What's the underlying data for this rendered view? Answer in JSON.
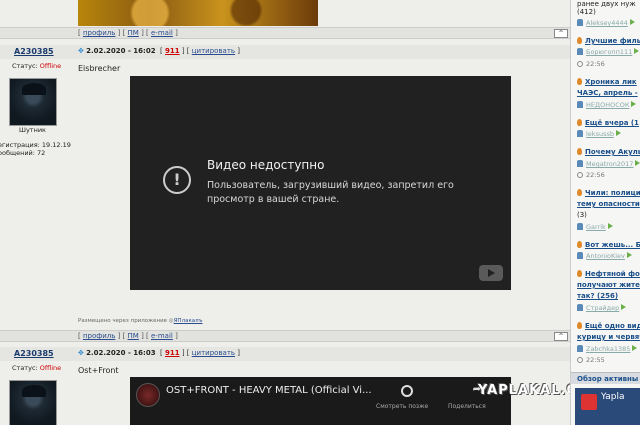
{
  "post_bar_links": [
    "профиль",
    "ПМ",
    "e-mail"
  ],
  "up_label": "^",
  "posts": [
    {
      "author": "A230385",
      "date": "2.02.2020 - 16:02",
      "number": "911",
      "quote": "цитировать",
      "status_label": "Статус:",
      "status_value": "Offline",
      "nick": "Шутник",
      "reg": "егистрация: 19.12.19",
      "count": "ообщений: 72",
      "title": "Eisbrecher",
      "video_title": "Видео недоступно",
      "video_desc": "Пользователь, загрузивший видео, запретил его просмотр в вашей стране.",
      "posted_via": "Размещено через приложение",
      "app_name": "ЯПлакалъ"
    },
    {
      "author": "A230385",
      "date": "2.02.2020 - 16:03",
      "number": "911",
      "quote": "цитировать",
      "status_label": "Статус:",
      "status_value": "Offline",
      "title": "Ost+Front",
      "video_title": "OST+FRONT - HEAVY METAL (Official Vi...",
      "watch_later": "Смотреть позже",
      "share": "Поделиться"
    }
  ],
  "sidebar": {
    "items": [
      {
        "type": "plain",
        "text": "ранее двух нуж"
      },
      {
        "type": "plain",
        "text": "(412)"
      },
      {
        "type": "user",
        "text": "Aleksey4444"
      },
      {
        "type": "hdr",
        "text": "Лучшие филь"
      },
      {
        "type": "user",
        "text": "Борюгопп111"
      },
      {
        "type": "time",
        "text": "22:56"
      },
      {
        "type": "hdr",
        "text": "Хроника лик"
      },
      {
        "type": "hdr",
        "text": "ЧАЭС, апрель -"
      },
      {
        "type": "user",
        "text": "НЕДОНОСОК"
      },
      {
        "type": "hdr",
        "text": "Ещё вчера (1"
      },
      {
        "type": "user",
        "text": "leksussb"
      },
      {
        "type": "hdr",
        "text": "Почему Акулы Б"
      },
      {
        "type": "user",
        "text": "Megatron2017"
      },
      {
        "type": "time",
        "text": "22:56"
      },
      {
        "type": "hdr",
        "text": "Чили: полиция"
      },
      {
        "type": "hdr",
        "text": "тему опасности"
      },
      {
        "type": "plain",
        "text": "(3)"
      },
      {
        "type": "user",
        "text": "Garrik"
      },
      {
        "type": "hdr",
        "text": "Вот жешь... Бац"
      },
      {
        "type": "user",
        "text": "AntonioKiev"
      },
      {
        "type": "hdr",
        "text": "Нефтяной фонд"
      },
      {
        "type": "hdr",
        "text": "получают жител"
      },
      {
        "type": "hdr",
        "text": "так? (256)"
      },
      {
        "type": "user",
        "text": "Страйдер"
      },
      {
        "type": "hdr",
        "text": "Ещё одно видео"
      },
      {
        "type": "hdr",
        "text": "курицу и червяч"
      },
      {
        "type": "user",
        "text": "Zabchka1385"
      },
      {
        "type": "time",
        "text": "22:55"
      }
    ],
    "active_header": "Обзор активны",
    "yaplakal_box": "Yapla"
  },
  "watermark": "YAPLAKAL.COM"
}
